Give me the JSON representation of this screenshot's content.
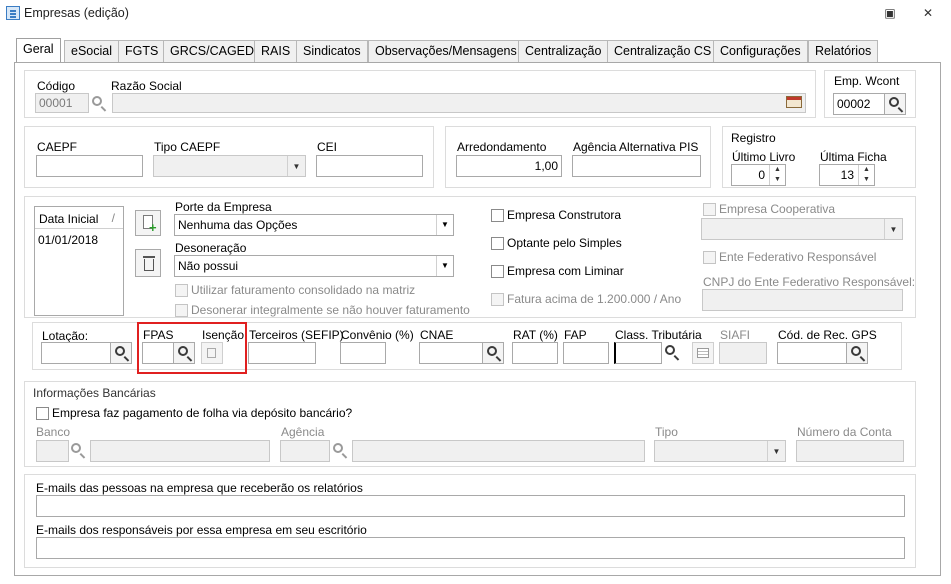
{
  "window": {
    "title": "Empresas (edição)",
    "maximize_glyph": "▣",
    "close_glyph": "✕"
  },
  "tabs": [
    {
      "label": "Geral"
    },
    {
      "label": "eSocial"
    },
    {
      "label": "FGTS"
    },
    {
      "label": "GRCS/CAGED"
    },
    {
      "label": "RAIS"
    },
    {
      "label": "Sindicatos"
    },
    {
      "label": "Observações/Mensagens"
    },
    {
      "label": "Centralização"
    },
    {
      "label": "Centralização CS"
    },
    {
      "label": "Configurações"
    },
    {
      "label": "Relatórios"
    }
  ],
  "identity": {
    "codigo_label": "Código",
    "codigo_value": "00001",
    "razao_label": "Razão Social",
    "razao_value": "",
    "wcont_label": "Emp. Wcont",
    "wcont_value": "00002"
  },
  "caepf": {
    "caepf_label": "CAEPF",
    "tipo_label": "Tipo CAEPF",
    "cei_label": "CEI",
    "arred_label": "Arredondamento",
    "arred_value": "1,00",
    "agencia_label": "Agência Alternativa PIS",
    "registro_label": "Registro",
    "ultimo_livro_label": "Último Livro",
    "ultimo_livro_value": "0",
    "ultima_ficha_label": "Última Ficha",
    "ultima_ficha_value": "13"
  },
  "porte": {
    "list_header": "Data Inicial",
    "list_rows": [
      "01/01/2018"
    ],
    "porte_label": "Porte da Empresa",
    "porte_value": "Nenhuma das Opções",
    "desoneracao_label": "Desoneração",
    "desoneracao_value": "Não possui",
    "utilizar_label": "Utilizar faturamento consolidado na matriz",
    "desonerar_label": "Desonerar integralmente se não houver faturamento",
    "construtora_label": "Empresa Construtora",
    "simples_label": "Optante pelo Simples",
    "liminar_label": "Empresa com Liminar",
    "fatura_label": "Fatura acima de 1.200.000 / Ano",
    "cooperativa_label": "Empresa Cooperativa",
    "ente_label": "Ente Federativo Responsável",
    "cnpj_ente_label": "CNPJ do Ente Federativo Responsável:"
  },
  "lotacao": {
    "lotacao_label": "Lotação:",
    "fpas_label": "FPAS",
    "isencao_label": "Isenção",
    "terceiros_label": "Terceiros (SEFIP)",
    "convenio_label": "Convênio (%)",
    "cnae_label": "CNAE",
    "rat_label": "RAT (%)",
    "fap_label": "FAP",
    "class_label": "Class. Tributária",
    "siafi_label": "SIAFI",
    "gps_label": "Cód. de Rec. GPS"
  },
  "bancarias": {
    "title": "Informações Bancárias",
    "deposito_label": "Empresa faz pagamento de folha via depósito bancário?",
    "banco_label": "Banco",
    "agencia_label": "Agência",
    "tipo_label": "Tipo",
    "conta_label": "Número da Conta"
  },
  "emails": {
    "relatorios_label": "E-mails das pessoas na empresa que receberão os relatórios",
    "responsaveis_label": "E-mails dos responsáveis por essa empresa em seu escritório"
  }
}
